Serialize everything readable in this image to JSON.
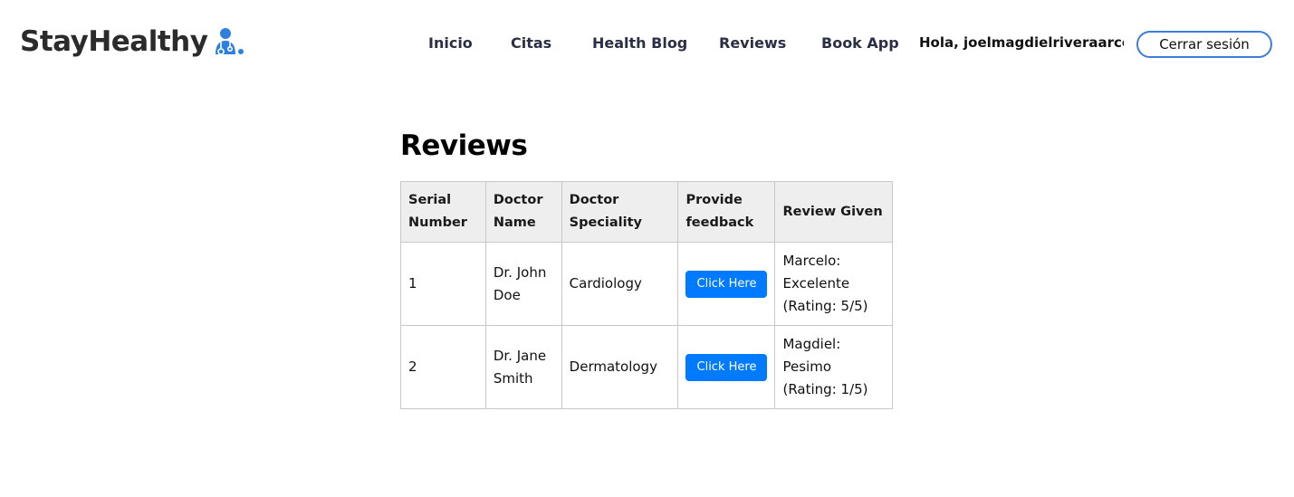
{
  "brand": {
    "name": "StayHealthy",
    "icon": "doctor-icon",
    "accent": "#2f7fe0"
  },
  "nav": {
    "links": [
      "Inicio",
      "Citas",
      "Health Blog",
      "Reviews",
      "Book App"
    ],
    "greeting": "Hola, joelmagdielriveraarce",
    "logout_label": "Cerrar sesión"
  },
  "main": {
    "title": "Reviews",
    "table": {
      "headers": [
        "Serial Number",
        "Doctor Name",
        "Doctor Speciality",
        "Provide feedback",
        "Review Given"
      ],
      "rows": [
        {
          "serial": "1",
          "doctor": "Dr. John Doe",
          "speciality": "Cardiology",
          "button": "Click Here",
          "review": "Marcelo: Excelente (Rating: 5/5)"
        },
        {
          "serial": "2",
          "doctor": "Dr. Jane Smith",
          "speciality": "Dermatology",
          "button": "Click Here",
          "review": "Magdiel: Pesimo (Rating: 1/5)"
        }
      ]
    }
  },
  "colors": {
    "button_primary": "#007bff",
    "logout_border": "#3d7ddb",
    "header_bg": "#eeeeee"
  }
}
